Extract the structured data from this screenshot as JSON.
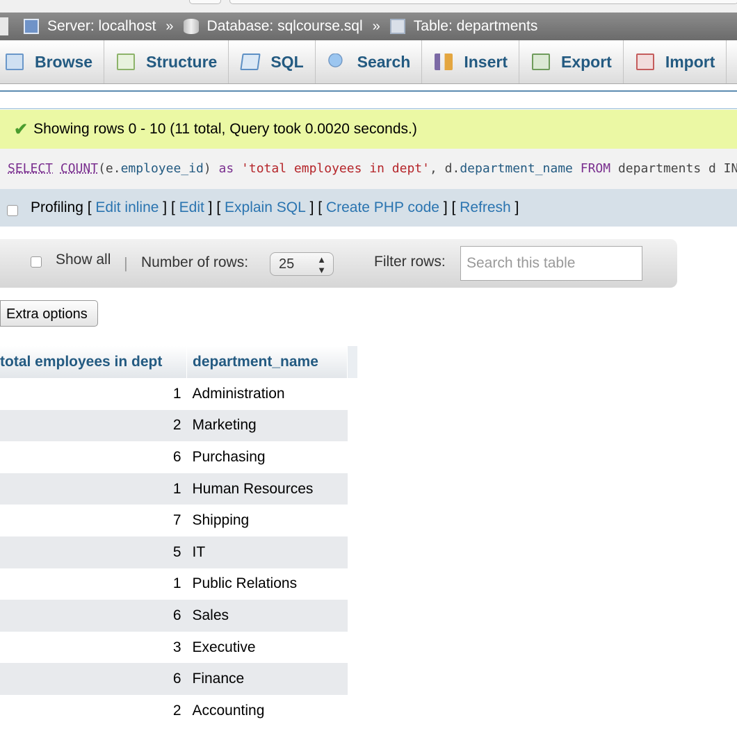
{
  "breadcrumb": {
    "server_label": "Server: localhost",
    "database_label": "Database: sqlcourse.sql",
    "table_label": "Table: departments",
    "separator": "»"
  },
  "tabs": [
    {
      "label": "Browse",
      "icon": "browse-icon"
    },
    {
      "label": "Structure",
      "icon": "structure-icon"
    },
    {
      "label": "SQL",
      "icon": "sql-icon"
    },
    {
      "label": "Search",
      "icon": "search-icon"
    },
    {
      "label": "Insert",
      "icon": "insert-icon"
    },
    {
      "label": "Export",
      "icon": "export-icon"
    },
    {
      "label": "Import",
      "icon": "import-icon"
    }
  ],
  "message": {
    "text": "Showing rows 0 - 10 (11 total, Query took 0.0020 seconds.)",
    "icon": "success-check-icon"
  },
  "sql": {
    "select": "SELECT",
    "count": "COUNT",
    "paren_open": "(",
    "alias_e": "e.",
    "col_employee_id": "employee_id",
    "paren_close": ")",
    "as": "as",
    "alias_string": "'total employees in dept'",
    "comma": ",",
    "alias_d": "d.",
    "col_department_name": "department_name",
    "from": "FROM",
    "tail": "departments d IN"
  },
  "profiling": {
    "label": "Profiling",
    "links": [
      "Edit inline",
      "Edit",
      "Explain SQL",
      "Create PHP code",
      "Refresh"
    ]
  },
  "navigation": {
    "show_all_label": "Show all",
    "number_of_rows_label": "Number of rows:",
    "number_of_rows_value": "25",
    "filter_label": "Filter rows:",
    "filter_placeholder": "Search this table"
  },
  "extra_options_label": "Extra options",
  "results": {
    "columns": [
      "total employees in dept",
      "department_name"
    ],
    "rows": [
      {
        "count": "1",
        "department": "Administration"
      },
      {
        "count": "2",
        "department": "Marketing"
      },
      {
        "count": "6",
        "department": "Purchasing"
      },
      {
        "count": "1",
        "department": "Human Resources"
      },
      {
        "count": "7",
        "department": "Shipping"
      },
      {
        "count": "5",
        "department": "IT"
      },
      {
        "count": "1",
        "department": "Public Relations"
      },
      {
        "count": "6",
        "department": "Sales"
      },
      {
        "count": "3",
        "department": "Executive"
      },
      {
        "count": "6",
        "department": "Finance"
      },
      {
        "count": "2",
        "department": "Accounting"
      }
    ]
  },
  "colors": {
    "link": "#2a74b0",
    "tab_text": "#235a81",
    "success_bg": "#ebf8a4",
    "sql_keyword": "#7a2f8f",
    "sql_string": "#b5252a"
  }
}
